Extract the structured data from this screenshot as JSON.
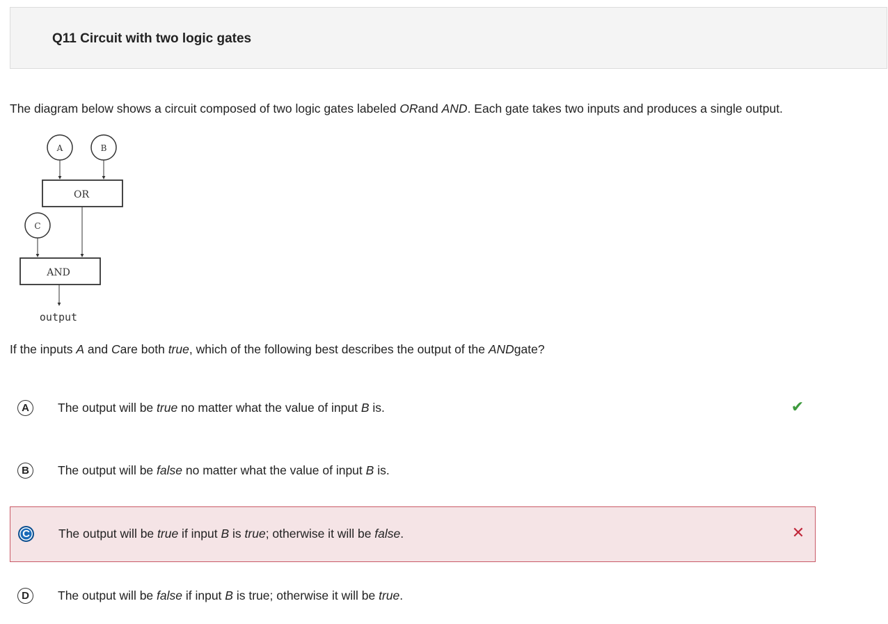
{
  "header": {
    "title": "Q11 Circuit with two logic gates"
  },
  "prompt": {
    "p1": "The diagram below shows a circuit composed of two logic gates labeled ",
    "or": "OR",
    "p2": "and ",
    "and": "AND",
    "p3": ". Each gate takes two inputs and produces a single output."
  },
  "diagram": {
    "input_a": "A",
    "input_b": "B",
    "input_c": "C",
    "gate_or": "OR",
    "gate_and": "AND",
    "output": "output"
  },
  "stem": {
    "p1": "If the inputs ",
    "a": "A",
    "p2": " and ",
    "c": "C",
    "p3": "are both ",
    "true": "true",
    "p4": ", which of the following best describes the output of the ",
    "and": "AND",
    "p5": "gate?"
  },
  "choices": [
    {
      "letter": "A",
      "t1": "The output will be ",
      "e1": "true",
      "t2": " no matter what the value of input ",
      "e2": "B",
      "t3": " is.",
      "mark": "✔",
      "status": "correct"
    },
    {
      "letter": "B",
      "t1": "The output will be ",
      "e1": "false",
      "t2": " no matter what the value of input ",
      "e2": "B",
      "t3": " is.",
      "mark": "",
      "status": ""
    },
    {
      "letter": "C",
      "t1": "The output will be ",
      "e1": "true",
      "t2": " if input ",
      "e2": "B",
      "t3": " is ",
      "e3": "true",
      "t4": "; otherwise it will be ",
      "e4": "false",
      "t5": ".",
      "mark": "✕",
      "status": "selected-wrong"
    },
    {
      "letter": "D",
      "t1": "The output will be ",
      "e1": "false",
      "t2": " if input ",
      "e2": "B",
      "t3": " is true; otherwise it will be ",
      "e3": "true",
      "t4": ".",
      "mark": "",
      "status": ""
    }
  ],
  "colors": {
    "correct": "#3d9a3d",
    "wrong": "#c0273a",
    "selected_bg": "#f5e4e6",
    "selected_letter": "#1a6bb8"
  }
}
